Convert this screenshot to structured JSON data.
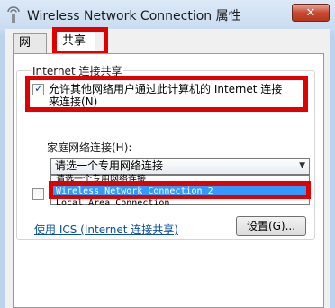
{
  "window": {
    "title": "Wireless Network Connection 属性",
    "close_glyph": "✕"
  },
  "tabs": [
    {
      "label": "网络",
      "active": false
    },
    {
      "label": "共享",
      "active": true
    }
  ],
  "sharing": {
    "group_title": "Internet 连接共享",
    "allow_checkbox_label_line1": "允许其他网络用户通过此计算机的 Internet 连接",
    "allow_checkbox_label_line2": "来连接(N)",
    "allow_checked": true,
    "home_network_label": "家庭网络连接(H):",
    "select_value": "请选一个专用网络连接",
    "dropdown_options": [
      "请选一个专用网络连接",
      "Wireless Network Connection 2",
      "Local Area Connection"
    ],
    "dropdown_highlighted_index": 1,
    "second_checked": false,
    "ics_link": "使用 ICS (Internet 连接共享)",
    "settings_button": "设置(G)..."
  },
  "colors": {
    "highlight": "#e00000",
    "selection": "#3399ff",
    "link": "#0a4fa0"
  }
}
